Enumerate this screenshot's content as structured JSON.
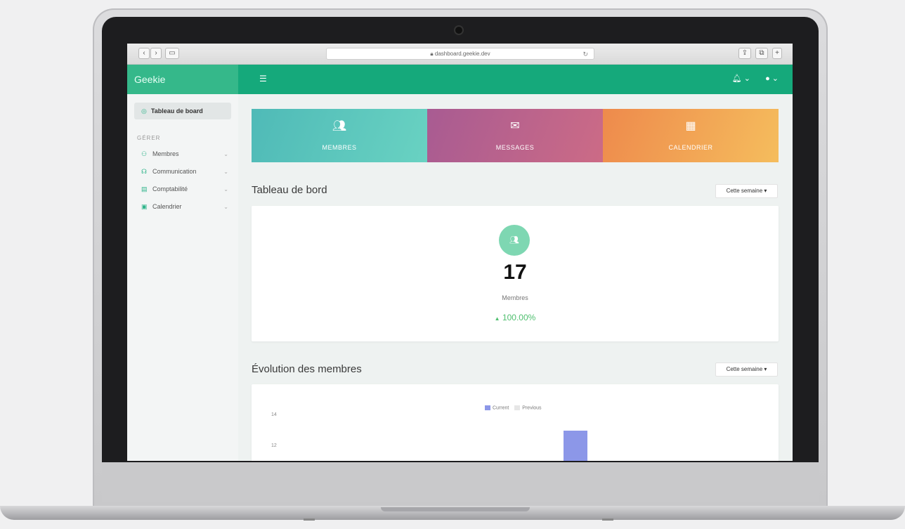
{
  "browser": {
    "url": "dashboard.geekie.dev"
  },
  "sidebar": {
    "brand": "Geekie",
    "active_item": "Tableau de board",
    "section_label": "GÉRER",
    "items": [
      {
        "label": "Membres",
        "icon": "members-icon"
      },
      {
        "label": "Communication",
        "icon": "chat-icon"
      },
      {
        "label": "Comptabilité",
        "icon": "table-icon"
      },
      {
        "label": "Calendrier",
        "icon": "calendar-icon"
      }
    ]
  },
  "tiles": [
    {
      "label": "MEMBRES",
      "icon": "users-icon",
      "color": "#5cc5bd"
    },
    {
      "label": "MESSAGES",
      "icon": "envelope-icon",
      "color": "#b96290"
    },
    {
      "label": "CALENDRIER",
      "icon": "calendar-icon",
      "color": "#f2a755"
    }
  ],
  "dashboard": {
    "title": "Tableau de bord",
    "period_button": "Cette semaine",
    "stat_value": "17",
    "stat_label": "Membres",
    "stat_change": "100.00%"
  },
  "evolution": {
    "title": "Évolution des membres",
    "period_button": "Cette semaine"
  },
  "chart_data": {
    "type": "bar",
    "series": [
      {
        "name": "Current",
        "color": "#8c97e8"
      },
      {
        "name": "Previous",
        "color": "#e6e6e6"
      }
    ],
    "y_ticks": [
      "14",
      "12"
    ],
    "visible_bar": {
      "series": "Current",
      "value_above": 12
    }
  },
  "colors": {
    "topbar": "#15a97b",
    "brand_bar": "#35b88a",
    "accent_green": "#4fbf6f"
  }
}
